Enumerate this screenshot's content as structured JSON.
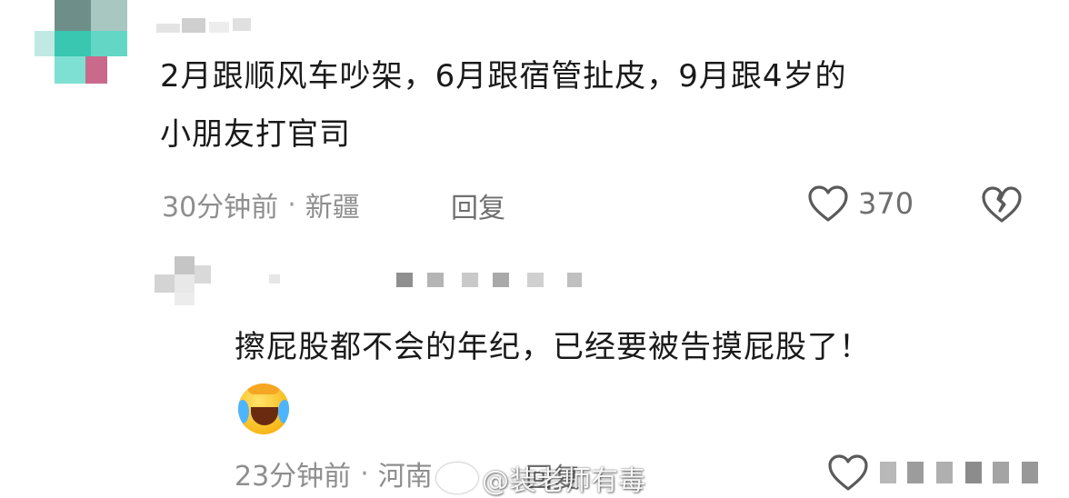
{
  "comments": [
    {
      "text_line1": "2月跟顺风车吵架，6月跟宿管扯皮，9月跟4岁的",
      "text_line2": "小朋友打官司",
      "time": "30分钟前",
      "location": "新疆",
      "separator": "·",
      "reply_label": "回复",
      "like_count": "370"
    },
    {
      "text_line1": "擦屁股都不会的年纪，已经要被告摸屁股了！",
      "emoji": "crying-laughing-face-icon",
      "time": "23分钟前",
      "location": "河南",
      "separator": "·",
      "reply_label": "回复"
    }
  ],
  "watermark": {
    "text": "@装老师有毒"
  },
  "colors": {
    "text": "#1a1a1a",
    "meta": "#8e8e8e",
    "icon": "#5a5a5a",
    "avatar1": "#5ed6c4"
  }
}
